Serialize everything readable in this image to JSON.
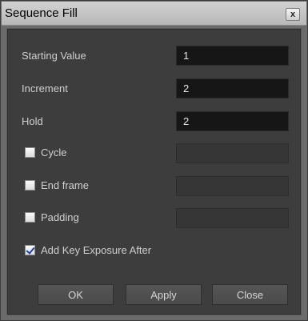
{
  "window": {
    "title": "Sequence Fill",
    "close_glyph": "x"
  },
  "fields": {
    "starting_value": {
      "label": "Starting Value",
      "value": "1"
    },
    "increment": {
      "label": "Increment",
      "value": "2"
    },
    "hold": {
      "label": "Hold",
      "value": "2"
    }
  },
  "options": {
    "cycle": {
      "label": "Cycle",
      "checked": false,
      "value": ""
    },
    "end_frame": {
      "label": "End frame",
      "checked": false,
      "value": ""
    },
    "padding": {
      "label": "Padding",
      "checked": false,
      "value": ""
    },
    "add_key_exposure_after": {
      "label": "Add Key Exposure After",
      "checked": true
    }
  },
  "buttons": {
    "ok": "OK",
    "apply": "Apply",
    "close": "Close"
  }
}
